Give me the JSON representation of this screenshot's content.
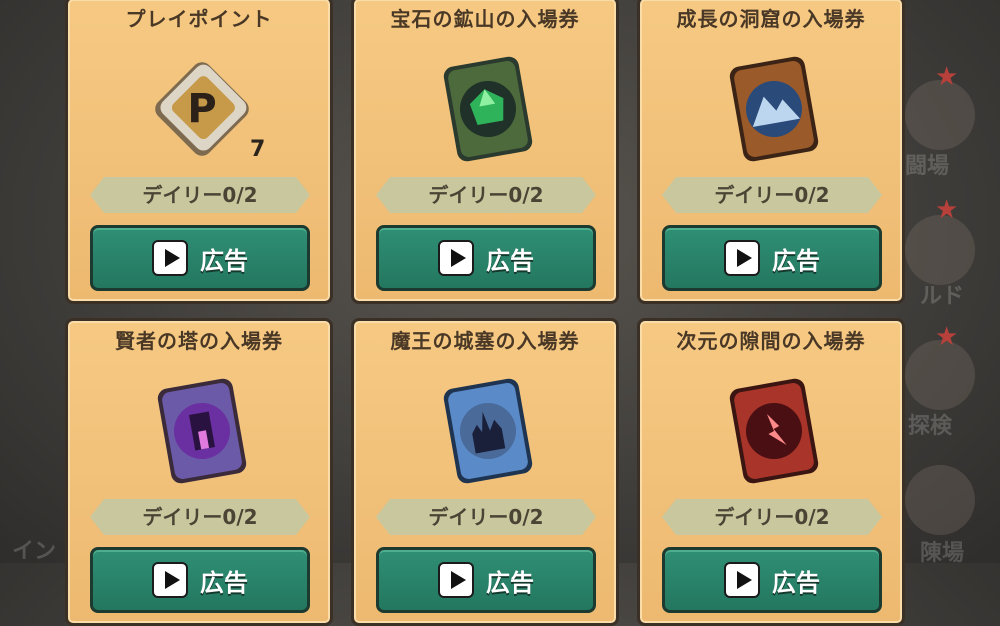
{
  "background": {
    "side_labels": [
      "闘場",
      "ルド",
      "探検",
      "陳場",
      "イン"
    ]
  },
  "cards": [
    {
      "title": "プレイポイント",
      "icon": "play-point-icon",
      "count": "7",
      "daily": "デイリー0/2",
      "ad_label": "広告"
    },
    {
      "title": "宝石の鉱山の入場券",
      "icon": "gem-mine-ticket-icon",
      "daily": "デイリー0/2",
      "ad_label": "広告"
    },
    {
      "title": "成長の洞窟の入場券",
      "icon": "growth-cave-ticket-icon",
      "daily": "デイリー0/2",
      "ad_label": "広告"
    },
    {
      "title": "賢者の塔の入場券",
      "icon": "sage-tower-ticket-icon",
      "daily": "デイリー0/2",
      "ad_label": "広告"
    },
    {
      "title": "魔王の城塞の入場券",
      "icon": "demon-fortress-ticket-icon",
      "daily": "デイリー0/2",
      "ad_label": "広告"
    },
    {
      "title": "次元の隙間の入場券",
      "icon": "dimension-rift-ticket-icon",
      "daily": "デイリー0/2",
      "ad_label": "広告"
    }
  ]
}
